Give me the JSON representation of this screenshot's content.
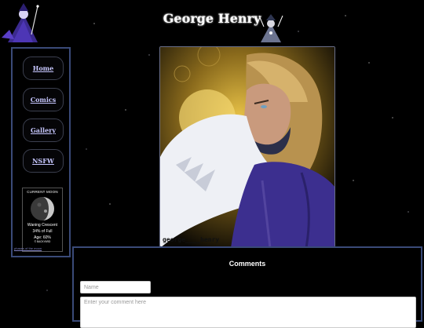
{
  "header": {
    "title": "George Henry"
  },
  "sidebar": {
    "items": [
      {
        "label": "Home"
      },
      {
        "label": "Comics"
      },
      {
        "label": "Gallery"
      },
      {
        "label": "NSFW"
      }
    ]
  },
  "moon_widget": {
    "heading": "CURRENT MOON",
    "phase": "Waning Crescent",
    "percent_full": "34% of Full",
    "age": "Age: 60%",
    "footnote": "© BACKYARD",
    "link": "phases of the moon"
  },
  "artwork": {
    "signature": "george____henry"
  },
  "comments": {
    "title": "Comments",
    "name_placeholder": "Name",
    "comment_placeholder": "Enter your comment here"
  },
  "colors": {
    "background": "#000000",
    "panel_border": "#3a4a78",
    "nav_link": "#c7c7ff"
  }
}
